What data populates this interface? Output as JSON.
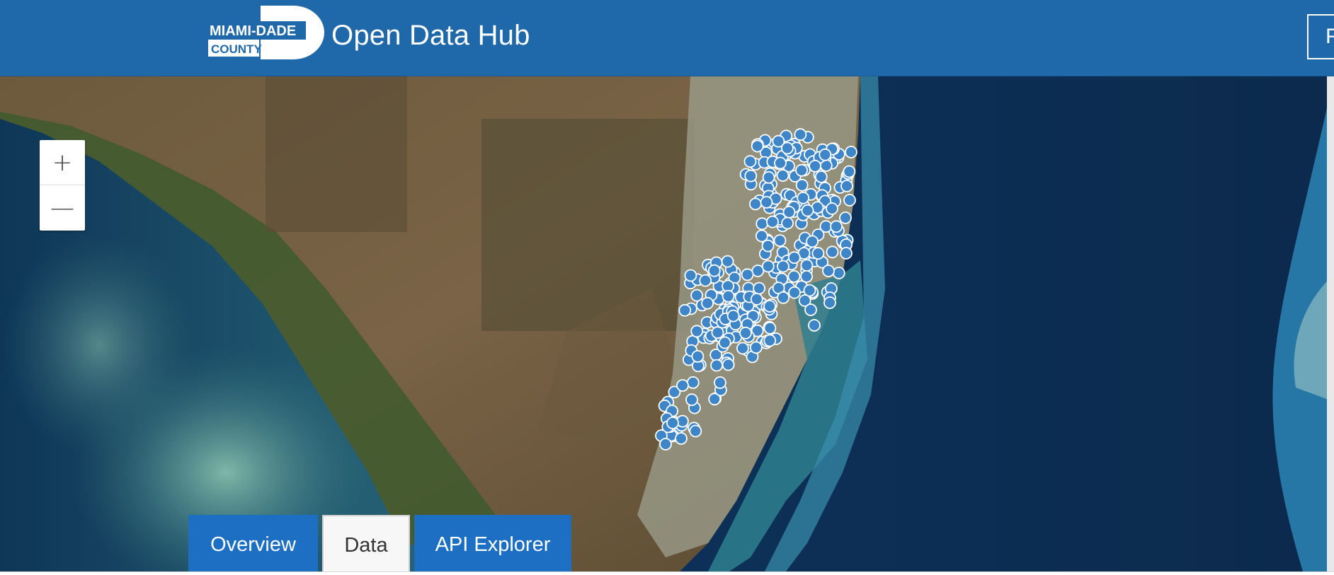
{
  "header": {
    "logo_line1": "MIAMI-DADE",
    "logo_line2": "COUNTY",
    "title": "Open Data Hub",
    "right_button_label": "F"
  },
  "map": {
    "zoom_in_label": "+",
    "zoom_out_label": "—",
    "basemap": "satellite imagery",
    "marker_color": "#3f86c8"
  },
  "tabs": [
    {
      "label": "Overview",
      "active": false
    },
    {
      "label": "Data",
      "active": true
    },
    {
      "label": "API Explorer",
      "active": false
    }
  ],
  "colors": {
    "header_bg": "#1f68a9",
    "tab_blue": "#1c6fc2"
  }
}
